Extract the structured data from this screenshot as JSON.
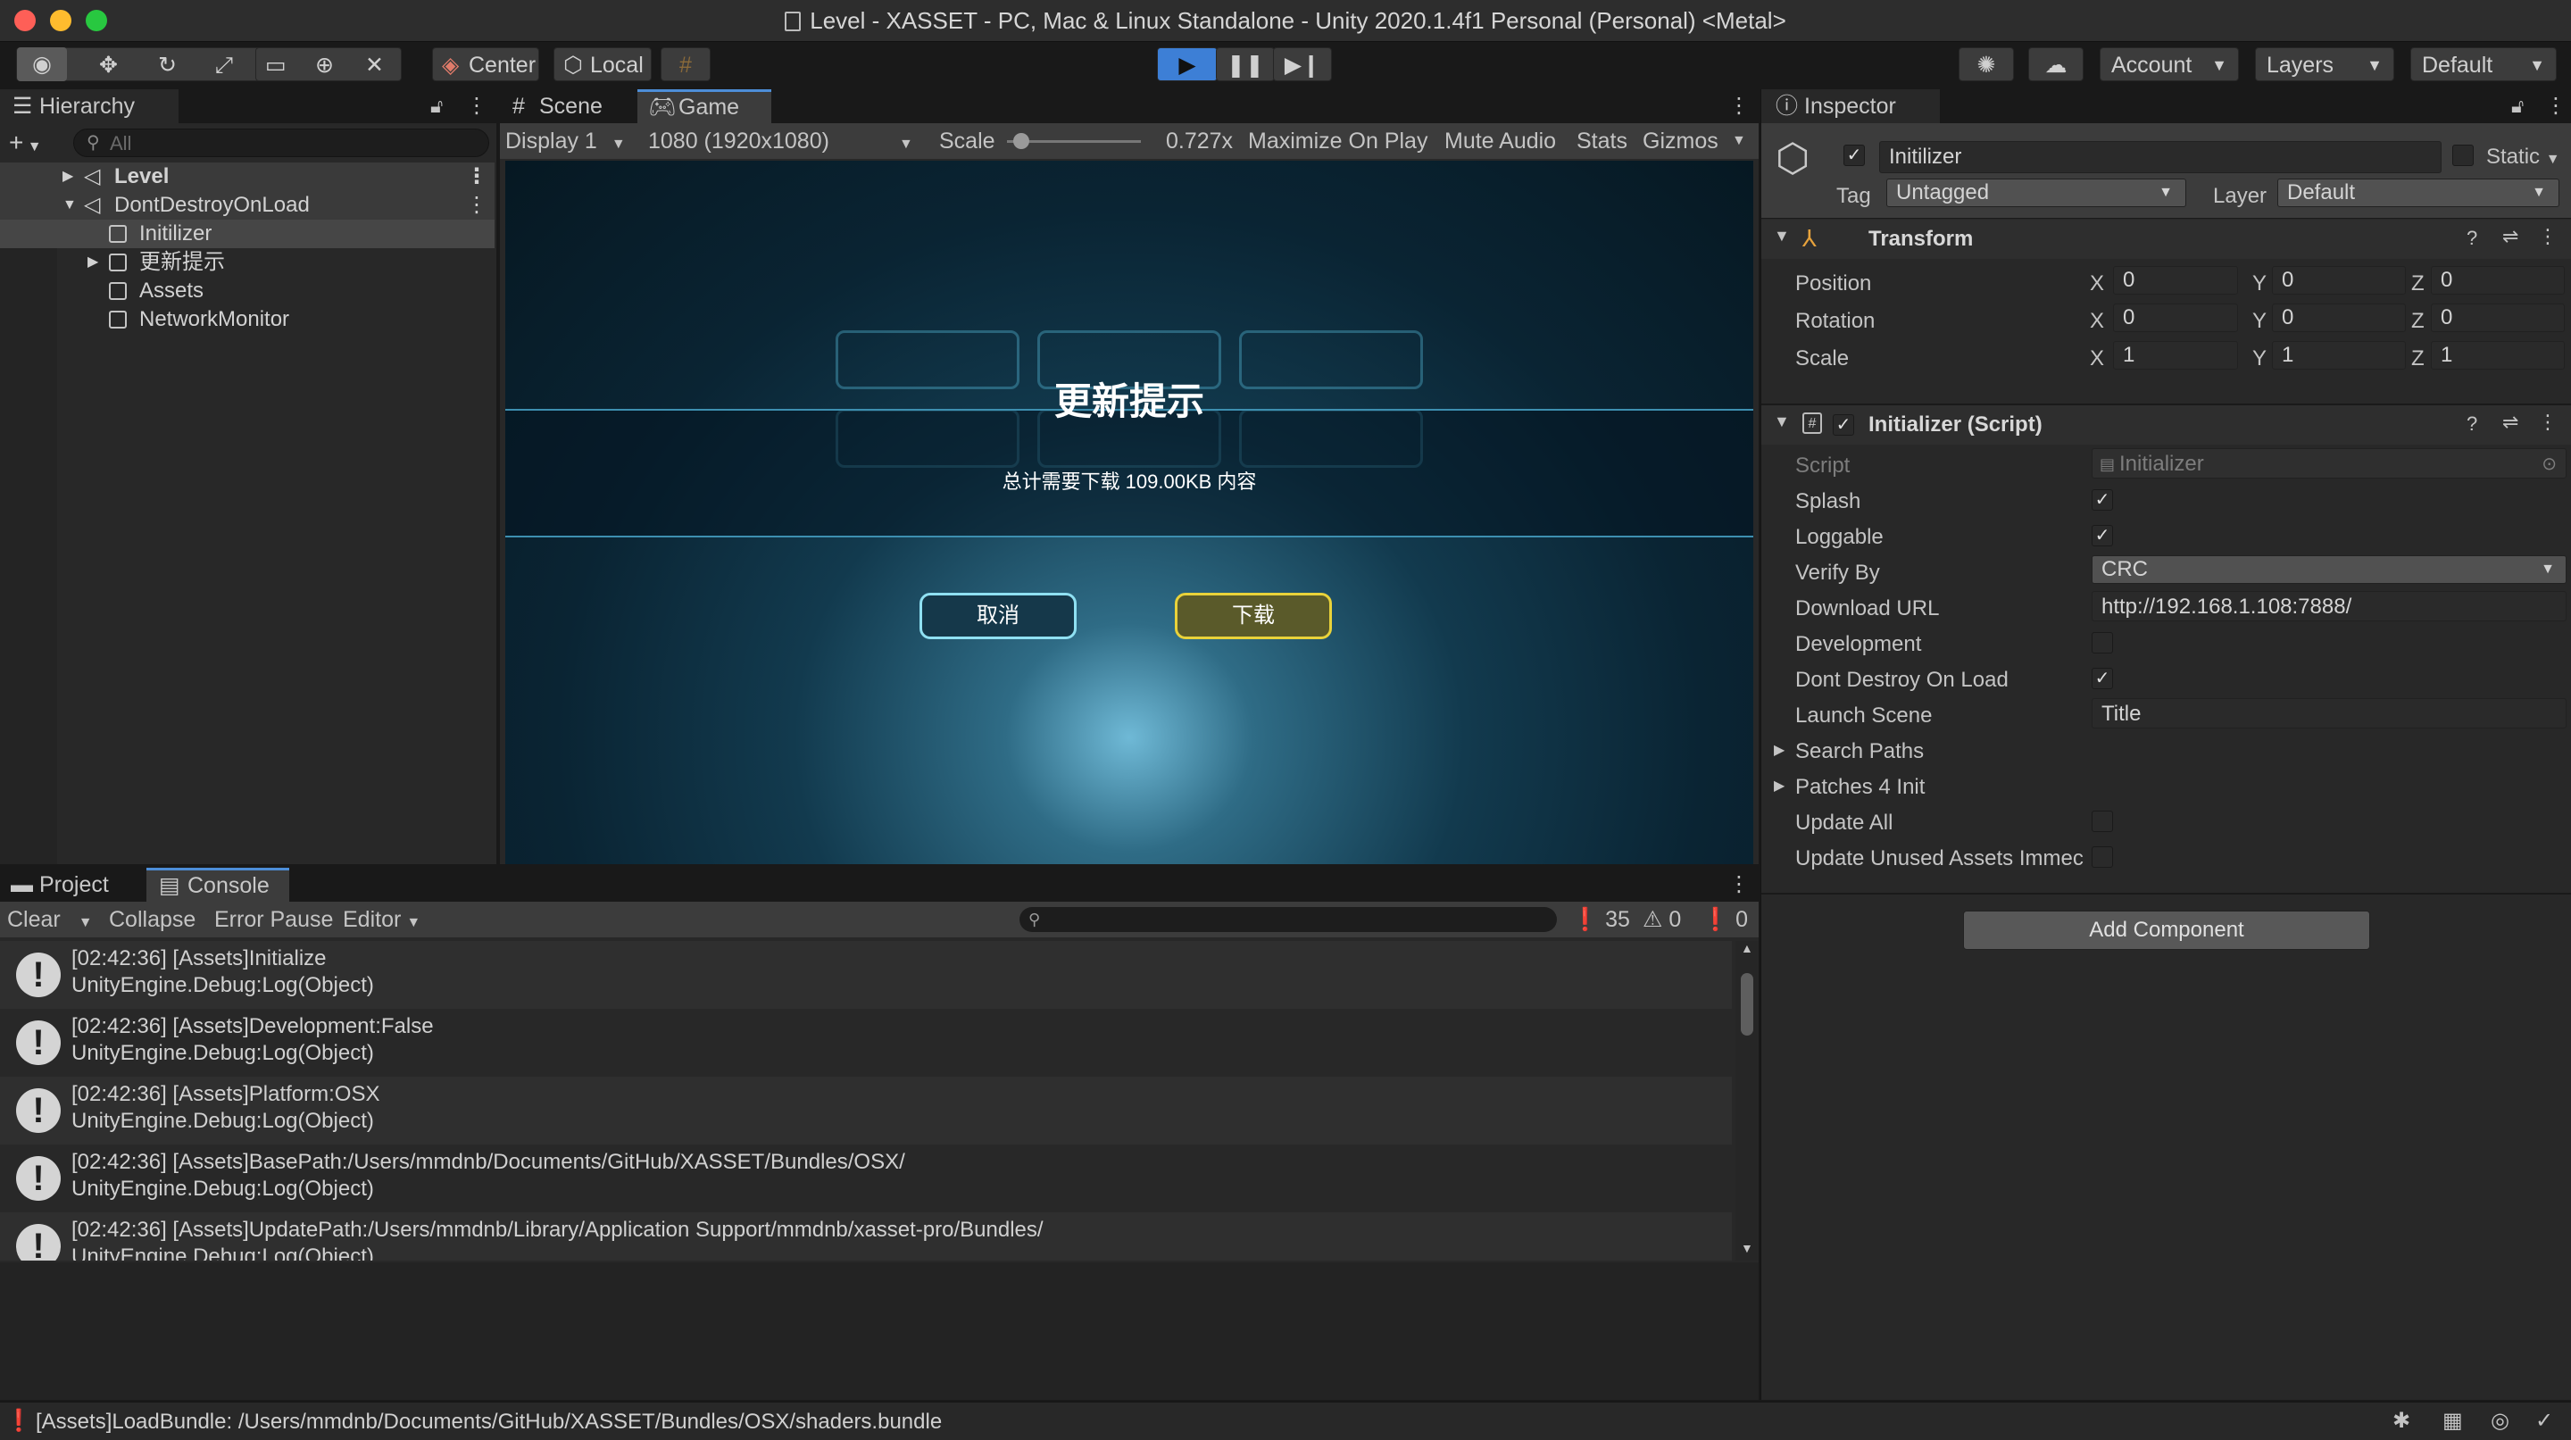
{
  "window": {
    "title": "Level - XASSET - PC, Mac & Linux Standalone - Unity 2020.1.4f1 Personal (Personal) <Metal>"
  },
  "toolbar": {
    "center_label": "Center",
    "local_label": "Local",
    "account_label": "Account",
    "layers_label": "Layers",
    "layout_label": "Default"
  },
  "hierarchy": {
    "tab_label": "Hierarchy",
    "search_placeholder": "All",
    "items": [
      {
        "label": "Level"
      },
      {
        "label": "DontDestroyOnLoad"
      },
      {
        "label": "Initilizer"
      },
      {
        "label": "更新提示"
      },
      {
        "label": "Assets"
      },
      {
        "label": "NetworkMonitor"
      }
    ]
  },
  "game_view": {
    "scene_tab": "Scene",
    "game_tab": "Game",
    "display": "Display 1",
    "resolution": "1080 (1920x1080)",
    "scale_label": "Scale",
    "scale_value": "0.727x",
    "scale_fraction": 0.05,
    "maximize": "Maximize On Play",
    "mute": "Mute Audio",
    "stats": "Stats",
    "gizmos": "Gizmos",
    "dialog": {
      "title": "更新提示",
      "message": "总计需要下载 109.00KB 内容",
      "cancel": "取消",
      "download": "下载"
    }
  },
  "console": {
    "project_tab": "Project",
    "console_tab": "Console",
    "clear": "Clear",
    "collapse": "Collapse",
    "error_pause": "Error Pause",
    "editor": "Editor",
    "log_count": "35",
    "warn_count": "0",
    "error_count": "0",
    "entries": [
      {
        "line1": "[02:42:36] [Assets]Initialize",
        "line2": "UnityEngine.Debug:Log(Object)"
      },
      {
        "line1": "[02:42:36] [Assets]Development:False",
        "line2": "UnityEngine.Debug:Log(Object)"
      },
      {
        "line1": "[02:42:36] [Assets]Platform:OSX",
        "line2": "UnityEngine.Debug:Log(Object)"
      },
      {
        "line1": "[02:42:36] [Assets]BasePath:/Users/mmdnb/Documents/GitHub/XASSET/Bundles/OSX/",
        "line2": "UnityEngine.Debug:Log(Object)"
      },
      {
        "line1": "[02:42:36] [Assets]UpdatePath:/Users/mmdnb/Library/Application Support/mmdnb/xasset-pro/Bundles/",
        "line2": "UnityEngine.Debug:Log(Object)"
      }
    ]
  },
  "inspector": {
    "tab_label": "Inspector",
    "object_name": "Initilizer",
    "static_label": "Static",
    "tag_label": "Tag",
    "tag_value": "Untagged",
    "layer_label": "Layer",
    "layer_value": "Default",
    "transform": {
      "title": "Transform",
      "position_label": "Position",
      "rotation_label": "Rotation",
      "scale_label": "Scale",
      "x": "X",
      "y": "Y",
      "z": "Z",
      "position": [
        "0",
        "0",
        "0"
      ],
      "rotation": [
        "0",
        "0",
        "0"
      ],
      "scale": [
        "1",
        "1",
        "1"
      ]
    },
    "script_component": {
      "title": "Initializer (Script)",
      "script_label": "Script",
      "script_value": "Initializer",
      "splash_label": "Splash",
      "loggable_label": "Loggable",
      "verify_label": "Verify By",
      "verify_value": "CRC",
      "download_label": "Download URL",
      "download_value": "http://192.168.1.108:7888/",
      "development_label": "Development",
      "dont_destroy_label": "Dont Destroy On Load",
      "launch_label": "Launch Scene",
      "launch_value": "Title",
      "search_paths_label": "Search Paths",
      "patches_label": "Patches 4 Init",
      "update_all_label": "Update All",
      "update_unused_label": "Update Unused Assets Immec"
    },
    "add_component": "Add Component"
  },
  "status_bar": {
    "message": "[Assets]LoadBundle: /Users/mmdnb/Documents/GitHub/XASSET/Bundles/OSX/shaders.bundle"
  },
  "colors": {
    "accent": "#4d8ed8",
    "play_active": "#3d7fd6",
    "panel": "#282828",
    "toolbar": "#191919"
  }
}
